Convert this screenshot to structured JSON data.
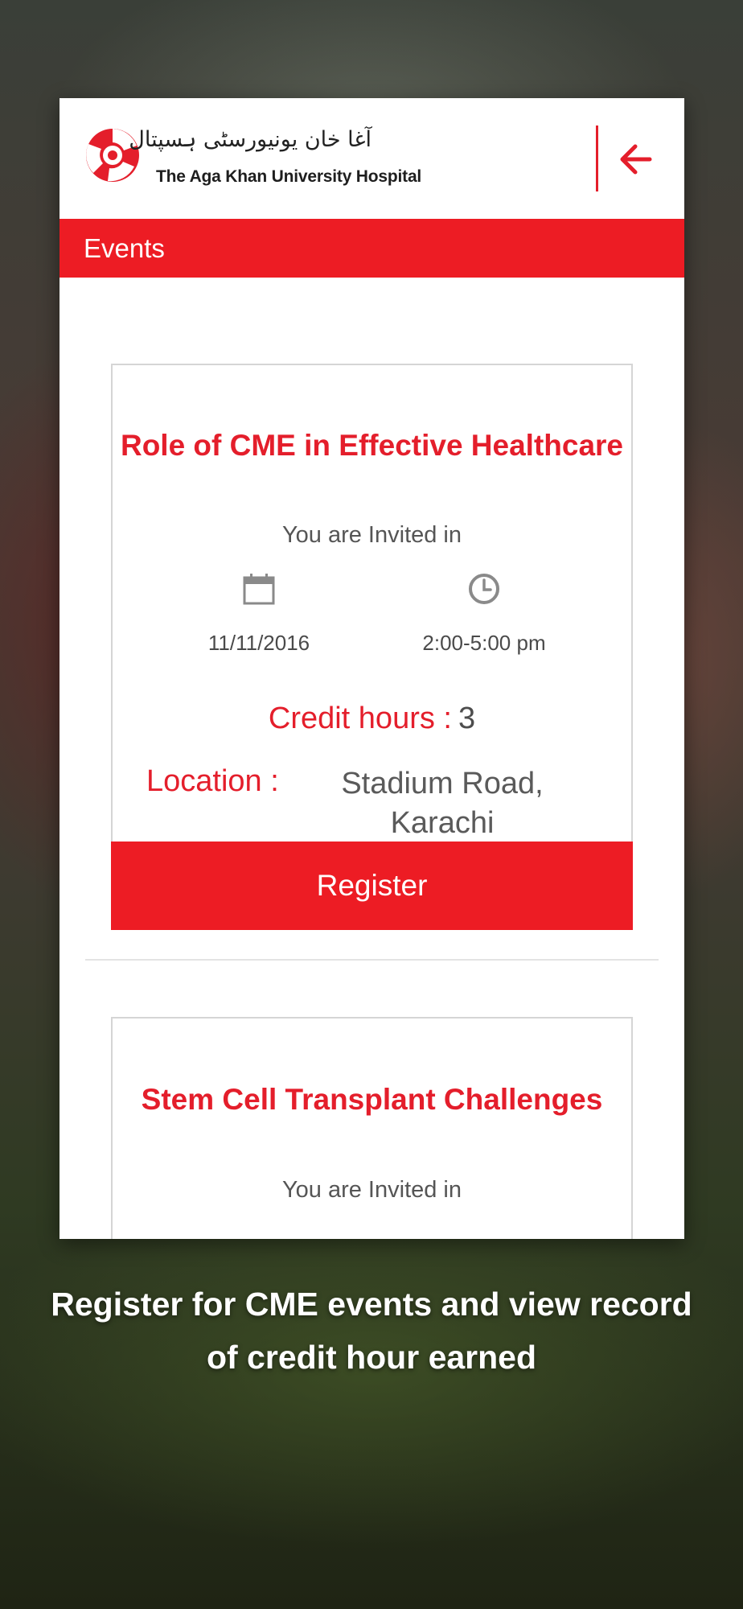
{
  "header": {
    "logo_urdu": "آغا خان یونیورسٹی ہسپتال",
    "logo_english": "The Aga Khan University Hospital",
    "back_icon": "arrow-left-icon",
    "accent_color": "#ed1c24"
  },
  "page": {
    "title": "Events"
  },
  "events": [
    {
      "title": "Role of CME in Effective Healthcare",
      "invited_text": "You are Invited in",
      "date": "11/11/2016",
      "time": "2:00-5:00 pm",
      "credit_label": "Credit hours :",
      "credit_value": "3",
      "location_label": "Location :",
      "location_value": "Stadium Road, Karachi",
      "register_label": "Register",
      "date_icon": "calendar-icon",
      "time_icon": "clock-icon"
    },
    {
      "title": "Stem Cell Transplant Challenges",
      "invited_text": "You are Invited in"
    }
  ],
  "promo": {
    "caption": "Register for CME events and view record of credit hour earned"
  }
}
